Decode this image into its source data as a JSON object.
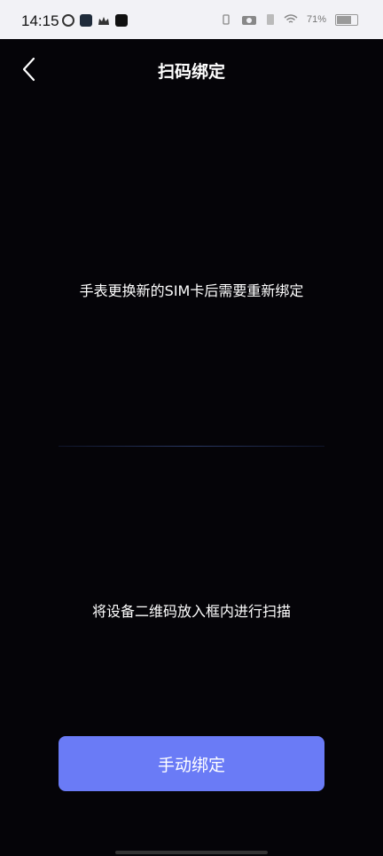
{
  "status_bar": {
    "time": "14:15",
    "battery": "71%",
    "battery_level": 0.71
  },
  "header": {
    "title": "扫码绑定"
  },
  "main": {
    "hint_top": "手表更换新的SIM卡后需要重新绑定",
    "hint_bottom": "将设备二维码放入框内进行扫描",
    "manual_button": "手动绑定"
  },
  "colors": {
    "primary_button": "#6a7bf6",
    "background": "#050408"
  }
}
